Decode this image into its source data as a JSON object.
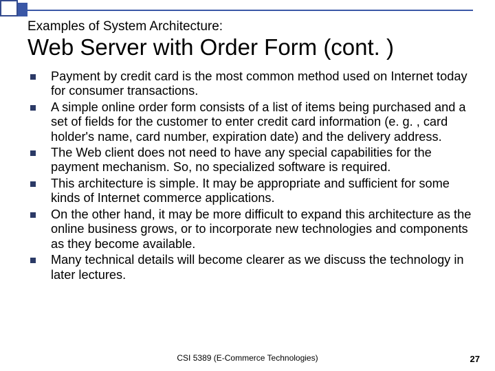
{
  "header": {
    "subtitle": "Examples of System Architecture:",
    "title": "Web Server with Order Form (cont. )"
  },
  "bullets": [
    "Payment by credit card is the most common method used on Internet today for consumer transactions.",
    "A simple online order form consists of a list of items being purchased and a set of fields for the customer to enter credit card information (e. g. , card holder's name, card number, expiration date) and the delivery address.",
    "The Web client does not need to have any special capabilities for the payment mechanism. So, no specialized software is required.",
    "This architecture is simple. It may be appropriate and sufficient for some kinds of Internet commerce applications.",
    "On the other hand, it may be more difficult to expand this architecture as the online business grows, or to incorporate new technologies and components as they become available.",
    "Many technical details will become clearer as we discuss the technology in later lectures."
  ],
  "footer": {
    "center": "CSI 5389 (E-Commerce Technologies)",
    "page": "27"
  }
}
